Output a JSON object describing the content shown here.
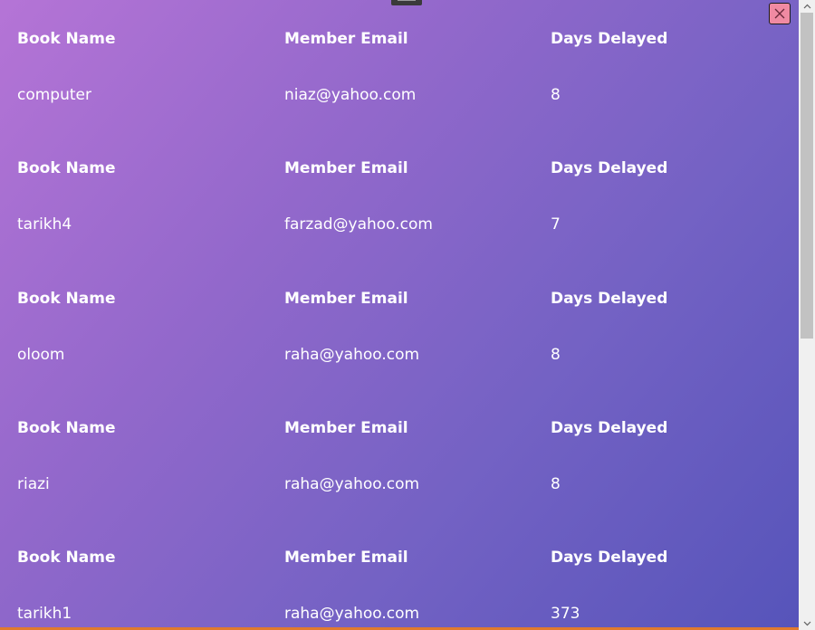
{
  "headers": {
    "book_name": "Book Name",
    "member_email": "Member Email",
    "days_delayed": "Days Delayed"
  },
  "records": [
    {
      "book_name": "computer",
      "member_email": "niaz@yahoo.com",
      "days_delayed": "8"
    },
    {
      "book_name": "tarikh4",
      "member_email": "farzad@yahoo.com",
      "days_delayed": "7"
    },
    {
      "book_name": "oloom",
      "member_email": "raha@yahoo.com",
      "days_delayed": "8"
    },
    {
      "book_name": "riazi",
      "member_email": "raha@yahoo.com",
      "days_delayed": "8"
    },
    {
      "book_name": "tarikh1",
      "member_email": "raha@yahoo.com",
      "days_delayed": "373"
    }
  ],
  "icons": {
    "close": "close-icon",
    "drag": "drag-handle-icon",
    "scroll_up": "chevron-up-icon",
    "scroll_down": "chevron-down-icon"
  },
  "colors": {
    "gradient_start": "#b574d6",
    "gradient_end": "#5654ba",
    "close_button": "#f08aa2",
    "text": "#ffffff"
  }
}
